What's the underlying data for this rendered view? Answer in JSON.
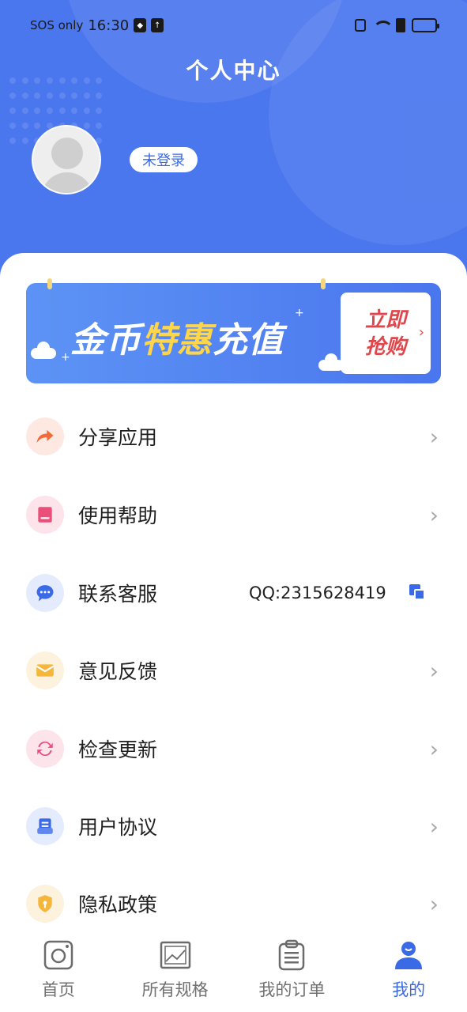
{
  "status_bar": {
    "carrier": "SOS only",
    "time": "16:30"
  },
  "header": {
    "title": "个人中心",
    "login_status": "未登录"
  },
  "banner": {
    "text_part1": "金币",
    "text_highlight": "特惠",
    "text_part2": "充值",
    "cta_line1": "立即",
    "cta_line2": "抢购"
  },
  "menu": {
    "items": [
      {
        "label": "分享应用",
        "icon": "share-icon",
        "color": "#f06a3b"
      },
      {
        "label": "使用帮助",
        "icon": "book-icon",
        "color": "#ea4f7a"
      },
      {
        "label": "联系客服",
        "icon": "chat-icon",
        "color": "#3a6ae6",
        "extra": "QQ:2315628419"
      },
      {
        "label": "意见反馈",
        "icon": "mail-icon",
        "color": "#f4b63b"
      },
      {
        "label": "检查更新",
        "icon": "refresh-icon",
        "color": "#e94f7e"
      },
      {
        "label": "用户协议",
        "icon": "document-icon",
        "color": "#3a6ae6"
      },
      {
        "label": "隐私政策",
        "icon": "shield-icon",
        "color": "#f4b63b"
      }
    ]
  },
  "tabs": [
    {
      "label": "首页",
      "icon": "camera-icon",
      "active": false
    },
    {
      "label": "所有规格",
      "icon": "image-icon",
      "active": false
    },
    {
      "label": "我的订单",
      "icon": "clipboard-icon",
      "active": false
    },
    {
      "label": "我的",
      "icon": "user-icon",
      "active": true
    }
  ],
  "colors": {
    "primary": "#4a76ee",
    "accent_red": "#e0474c",
    "accent_yellow": "#ffd54a"
  }
}
